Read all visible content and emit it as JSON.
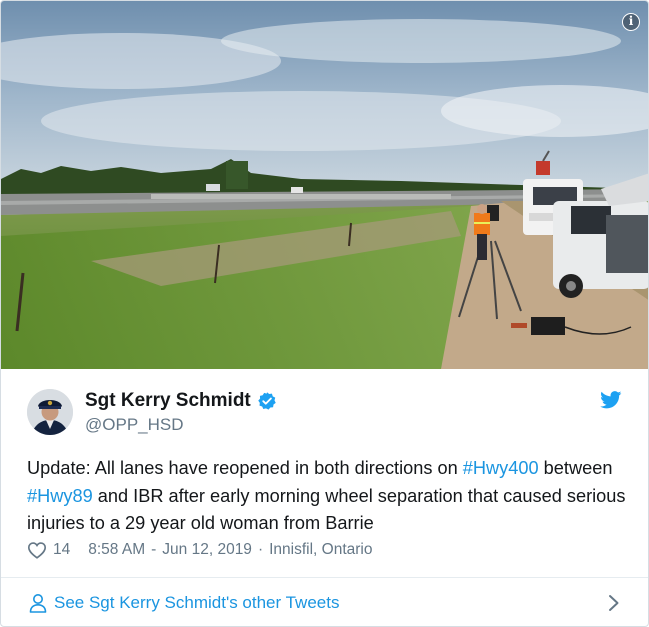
{
  "tweet": {
    "author": {
      "display_name": "Sgt Kerry Schmidt",
      "handle": "@OPP_HSD",
      "verified": true
    },
    "text_segments": [
      {
        "text": "Update: All lanes have reopened in both directions on ",
        "type": "text"
      },
      {
        "text": "#Hwy400",
        "type": "hashtag"
      },
      {
        "text": " between ",
        "type": "text"
      },
      {
        "text": "#Hwy89",
        "type": "hashtag"
      },
      {
        "text": " and IBR after early morning wheel separation that caused serious injuries to a 29 year old woman from Barrie",
        "type": "text"
      }
    ],
    "likes": "14",
    "time": "8:58 AM",
    "date": "Jun 12, 2019",
    "location": "Innisfil, Ontario",
    "separator": "-",
    "dot": "·"
  },
  "footer": {
    "label": "See Sgt Kerry Schmidt's other Tweets"
  },
  "photo": {
    "info_glyph": "i"
  },
  "icons": {
    "info": "info-icon",
    "verified": "verified-badge-icon",
    "platform": "twitter-bird-icon",
    "like": "heart-icon",
    "person": "person-icon",
    "chevron": "chevron-right-icon"
  },
  "colors": {
    "link": "#1b95e0",
    "secondary_text": "#657786",
    "primary_text": "#14171a",
    "border": "#e6ecf0"
  }
}
